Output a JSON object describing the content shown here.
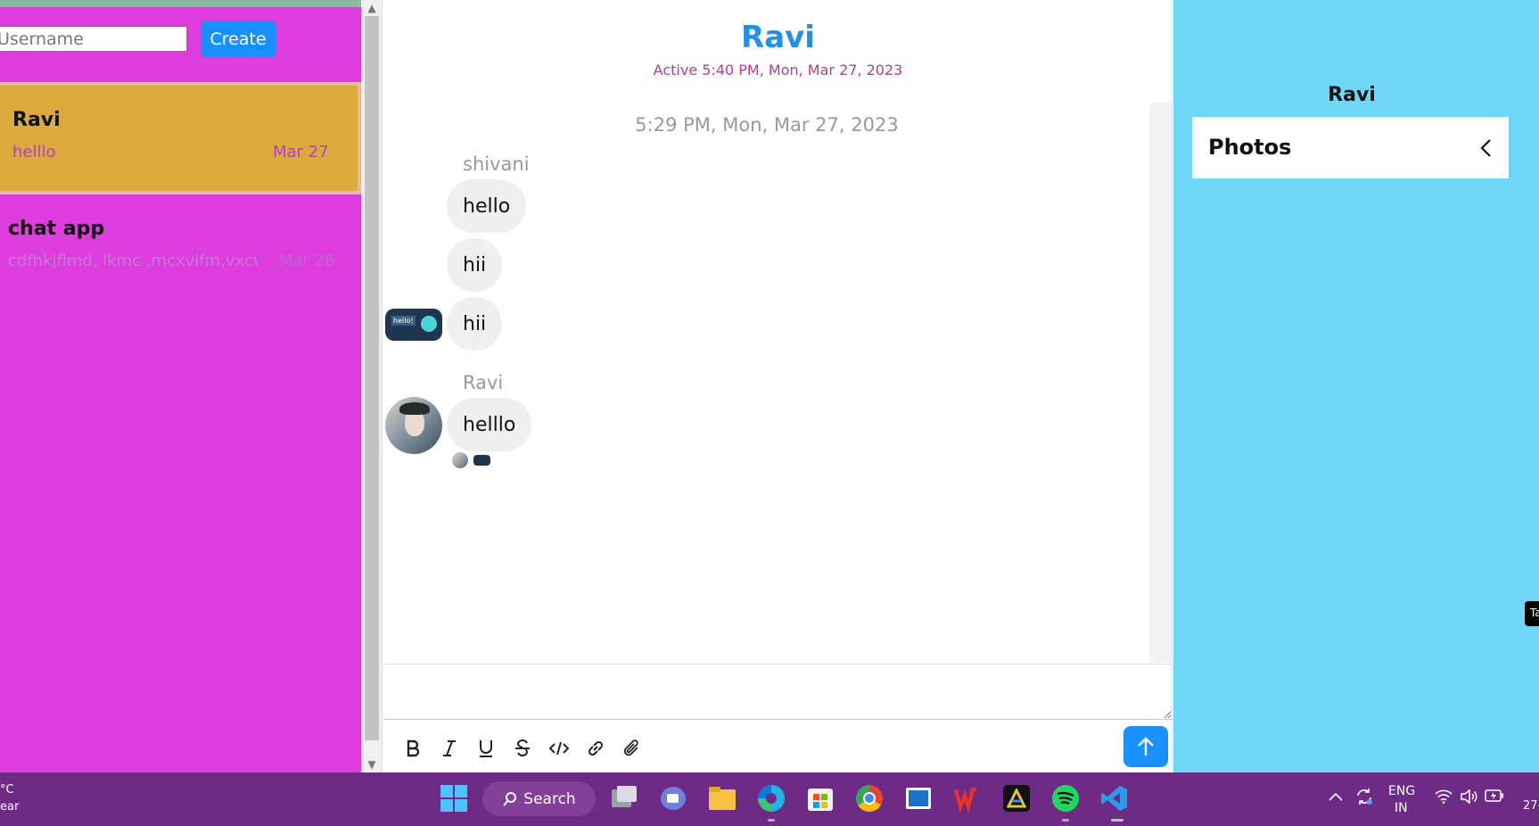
{
  "sidebar": {
    "username_placeholder": "Username",
    "create_label": "Create",
    "chats": [
      {
        "title": "Ravi",
        "preview": "helllo",
        "date": "Mar 27",
        "active": true
      },
      {
        "title": "chat app",
        "preview": "cdfhkjflmd, lkmc ,mcxvifm,vxcv",
        "date": "Mar 26",
        "active": false
      }
    ]
  },
  "chat": {
    "title": "Ravi",
    "status": "Active 5:40 PM, Mon, Mar 27, 2023",
    "timestamp": "5:29 PM, Mon, Mar 27, 2023",
    "groups": [
      {
        "sender": "shivani",
        "messages": [
          "hello",
          "hii",
          "hii"
        ]
      },
      {
        "sender": "Ravi",
        "messages": [
          "helllo"
        ]
      }
    ],
    "avatar_badge_text": "hello!",
    "toolbar": [
      "bold-icon",
      "italic-icon",
      "underline-icon",
      "strikethrough-icon",
      "code-icon",
      "link-icon",
      "attachment-icon"
    ]
  },
  "details": {
    "title": "Ravi",
    "photos_label": "Photos",
    "tooltip_text": "Ta"
  },
  "taskbar": {
    "weather_temp": "°C",
    "weather_text": "ear",
    "search_label": "Search",
    "lang_top": "ENG",
    "lang_bottom": "IN",
    "clock": "27-"
  },
  "colors": {
    "sidebar_bg": "#dc3ddc",
    "active_card": "#dbaa3c",
    "accent": "#1890ff",
    "details_bg": "#6dd7f5",
    "taskbar_bg": "#6e2b86",
    "status_text": "#b0408f"
  }
}
